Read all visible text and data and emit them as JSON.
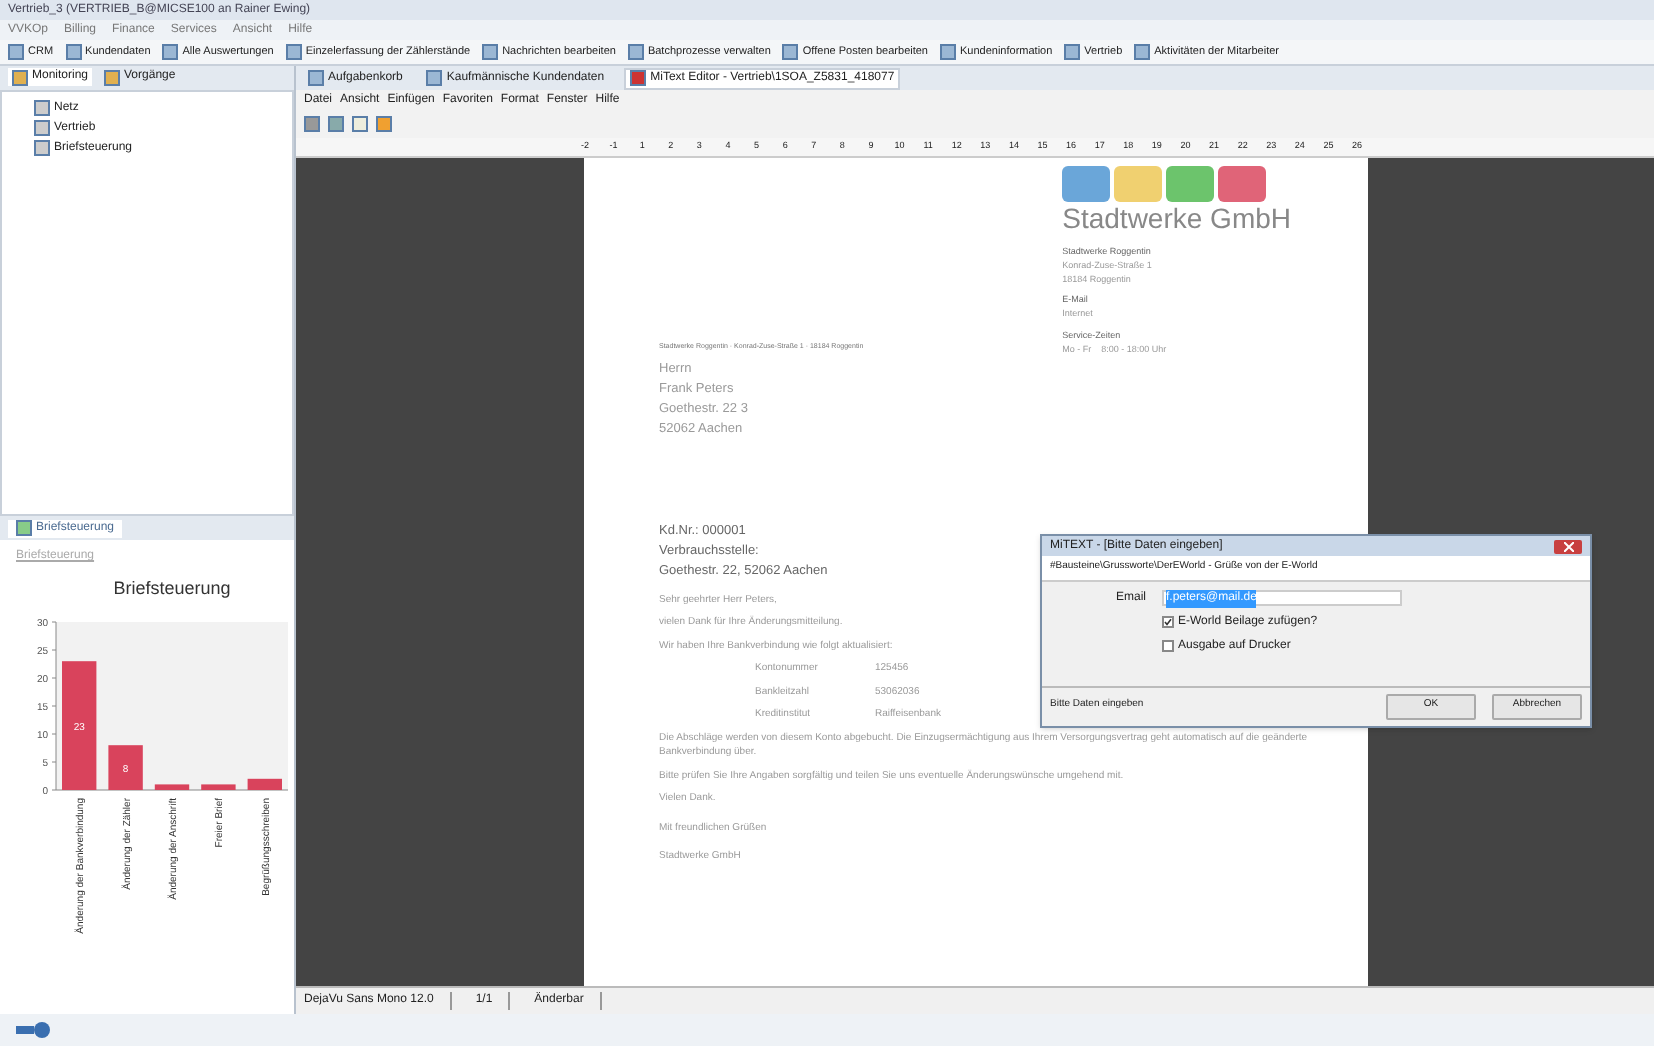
{
  "window": {
    "title": "Vertrieb_3 (VERTRIEB_B@MICSE100 an Rainer Ewing)"
  },
  "menu": [
    "VVKOp",
    "Billing",
    "Finance",
    "Services",
    "Ansicht",
    "Hilfe"
  ],
  "toolbar": [
    "CRM",
    "Kundendaten",
    "Alle Auswertungen",
    "Einzelerfassung der Zählerstände",
    "Nachrichten bearbeiten",
    "Batchprozesse verwalten",
    "Offene Posten bearbeiten",
    "Kundeninformation",
    "Vertrieb",
    "Aktivitäten der Mitarbeiter"
  ],
  "view_tabs": [
    {
      "label": "Monitoring",
      "selected": true
    },
    {
      "label": "Vorgänge",
      "selected": false
    }
  ],
  "editor_tabs": [
    {
      "label": "Aufgabenkorb",
      "selected": false
    },
    {
      "label": "Kaufmännische Kundendaten",
      "selected": false
    },
    {
      "label": "MiText Editor - Vertrieb\\1SOA_Z5831_418077",
      "selected": true
    }
  ],
  "tree": [
    {
      "label": "Netz"
    },
    {
      "label": "Vertrieb"
    },
    {
      "label": "Briefsteuerung"
    }
  ],
  "chart_pane": {
    "tab": "Briefsteuerung",
    "link": "Briefsteuerung",
    "chart_data": {
      "type": "bar",
      "title": "Briefsteuerung",
      "categories": [
        "Änderung der Bankverbindung",
        "Änderung der Zähler",
        "Änderung der Anschrift",
        "Freier Brief",
        "Begrüßungsschreiben"
      ],
      "values": [
        23,
        8,
        1,
        1,
        2
      ],
      "ylim": [
        0,
        30
      ],
      "yticks": [
        0,
        5,
        10,
        15,
        20,
        25,
        30
      ],
      "value_labels": [
        "23",
        "8",
        null,
        null,
        null
      ]
    }
  },
  "editor": {
    "menu": [
      "Datei",
      "Ansicht",
      "Einfügen",
      "Favoriten",
      "Format",
      "Fenster",
      "Hilfe"
    ],
    "ruler": [
      "-2",
      "-1",
      "1",
      "2",
      "3",
      "4",
      "5",
      "6",
      "7",
      "8",
      "9",
      "10",
      "11",
      "12",
      "13",
      "14",
      "15",
      "16",
      "17",
      "18",
      "19",
      "20",
      "21",
      "22",
      "23",
      "24",
      "25",
      "26"
    ],
    "letter": {
      "company": "Stadtwerke GmbH",
      "sender_line": "Stadtwerke Roggentin · Konrad-Zuse-Straße 1 · 18184 Roggentin",
      "address": [
        "Herrn",
        "Frank Peters",
        "Goethestr. 22 3",
        "52062 Aachen"
      ],
      "contact": [
        [
          "Stadtwerke Roggentin",
          "Konrad-Zuse-Straße 1",
          "18184 Roggentin"
        ],
        [
          "E-Mail",
          "Internet"
        ],
        [
          "Service-Zeiten",
          "Mo - Fr    8:00 - 18:00 Uhr"
        ]
      ],
      "reference": [
        "Kd.Nr.: 000001",
        "Verbrauchsstelle:",
        "Goethestr. 22, 52062 Aachen"
      ],
      "intro": [
        "Sehr geehrter Herr Peters,",
        "vielen Dank für Ihre Änderungsmitteilung.",
        "Wir haben Ihre Bankverbindung wie folgt aktualisiert:"
      ],
      "bank": [
        {
          "label": "Kontonummer",
          "value": "125456"
        },
        {
          "label": "Bankleitzahl",
          "value": "53062036"
        },
        {
          "label": "Kreditinstitut",
          "value": "Raiffeisenbank"
        }
      ],
      "body": [
        "Die Abschläge werden von diesem Konto abgebucht. Die Einzugsermächtigung aus Ihrem Versorgungsvertrag geht automatisch auf die geänderte Bankverbindung über.",
        "Bitte prüfen Sie Ihre Angaben sorgfältig und teilen Sie uns eventuelle Änderungswünsche umgehend mit.",
        "Vielen Dank."
      ],
      "closing": [
        "Mit freundlichen Grüßen",
        "Stadtwerke GmbH"
      ]
    },
    "status": [
      "DejaVu Sans Mono 12.0",
      "1/1",
      "Änderbar"
    ]
  },
  "dialog": {
    "title": "MiTEXT - [Bitte Daten eingeben]",
    "header": "#Bausteine\\Grussworte\\DerEWorld - Grüße von der E-World",
    "email_label": "Email",
    "email_value": "f.peters@mail.de",
    "email_selected": true,
    "options": [
      {
        "label": "E-World Beilage zufügen?",
        "checked": true
      },
      {
        "label": "Ausgabe auf Drucker",
        "checked": false
      }
    ],
    "hint": "Bitte Daten eingeben",
    "buttons": [
      "OK",
      "Abbrechen"
    ]
  }
}
